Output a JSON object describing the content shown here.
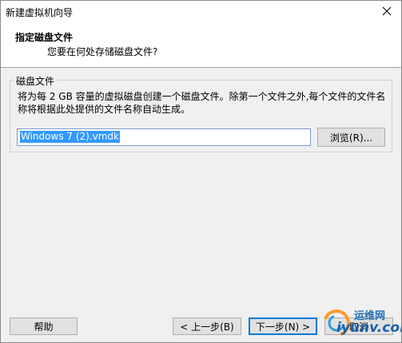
{
  "window": {
    "title": "新建虚拟机向导",
    "close_glyph": "✕"
  },
  "header": {
    "title": "指定磁盘文件",
    "subtitle": "您要在何处存储磁盘文件?"
  },
  "disk_file": {
    "group_label": "磁盘文件",
    "description": "将为每 2 GB 容量的虚拟磁盘创建一个磁盘文件。除第一个文件之外,每个文件的文件名称将根据此处提供的文件名称自动生成。",
    "filename_value": "Windows 7 (2).vmdk",
    "browse_label": "浏览(R)..."
  },
  "footer": {
    "help_label": "帮助",
    "back_label": "< 上一步(B)",
    "next_label": "下一步(N) >",
    "cancel_label": "取消"
  },
  "watermark": {
    "text": "运维网",
    "url": "iyunv.com"
  },
  "colors": {
    "accent": "#0078d7",
    "selection": "#3399ff"
  }
}
